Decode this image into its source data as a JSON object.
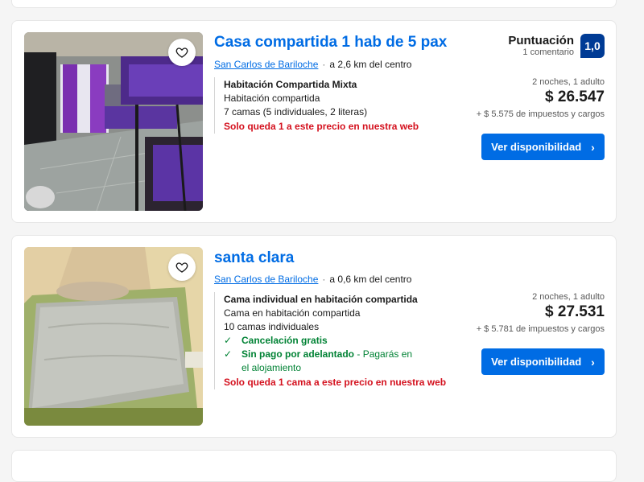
{
  "listings": [
    {
      "title": "Casa compartida 1 hab de 5 pax",
      "city": "San Carlos de Bariloche",
      "distance": "a 2,6 km del centro",
      "room_name": "Habitación Compartida Mixta",
      "room_type": "Habitación compartida",
      "beds": "7 camas (5 individuales, 2 literas)",
      "urgency": "Solo queda 1 a este precio en nuestra web",
      "score_label": "Puntuación",
      "reviews": "1 comentario",
      "score": "1,0",
      "stay": "2 noches, 1 adulto",
      "price": "$ 26.547",
      "taxes": "+ $ 5.575 de impuestos y cargos",
      "button": "Ver disponibilidad"
    },
    {
      "title": "santa clara",
      "city": "San Carlos de Bariloche",
      "distance": "a 0,6 km del centro",
      "room_name": "Cama individual en habitación compartida",
      "room_type": "Cama en habitación compartida",
      "beds": "10 camas individuales",
      "perk1": "Cancelación gratis",
      "perk2": "Sin pago por adelantado",
      "perk2_note": "- Pagarás en el alojamiento",
      "urgency": "Solo queda 1 cama a este precio en nuestra web",
      "stay": "2 noches, 1 adulto",
      "price": "$ 27.531",
      "taxes": "+ $ 5.781 de impuestos y cargos",
      "button": "Ver disponibilidad"
    }
  ],
  "icons": {
    "favorite": "heart-outline-icon",
    "check": "checkmark-icon",
    "chevron": "chevron-right-icon"
  },
  "colors": {
    "link": "#006ce4",
    "badge": "#003b95",
    "urgency": "#d4111e",
    "positive": "#008234"
  }
}
